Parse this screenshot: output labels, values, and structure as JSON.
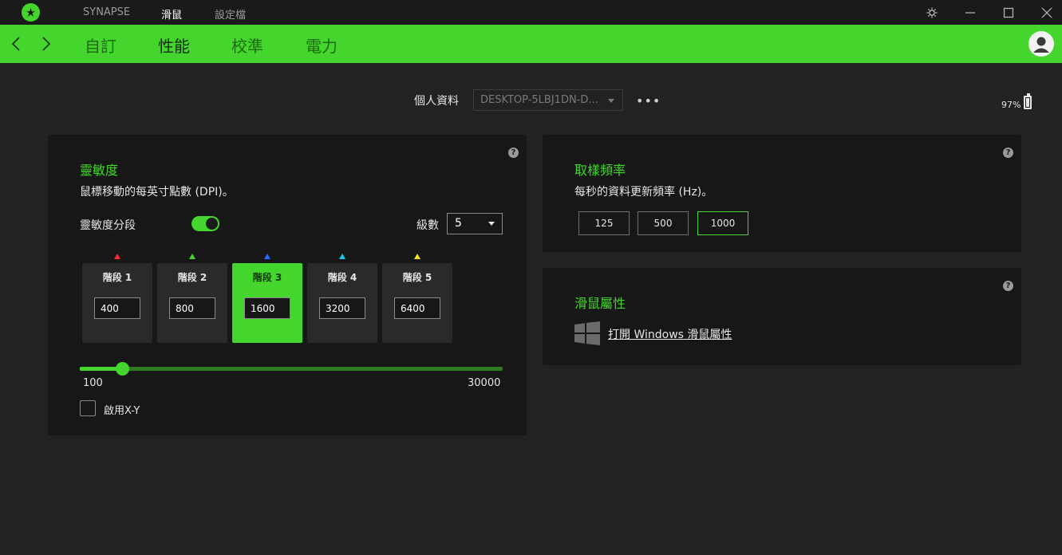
{
  "titlebar": {
    "logo_icon": "razer-snake-icon",
    "tabs": [
      {
        "label": "SYNAPSE",
        "active": false
      },
      {
        "label": "滑鼠",
        "active": true
      },
      {
        "label": "設定檔",
        "active": false
      }
    ],
    "controls": [
      "gear-icon",
      "minimize-icon",
      "maximize-icon",
      "close-icon"
    ]
  },
  "nav": {
    "tabs": [
      {
        "label": "自訂",
        "active": false
      },
      {
        "label": "性能",
        "active": true
      },
      {
        "label": "校準",
        "active": false
      },
      {
        "label": "電力",
        "active": false
      }
    ],
    "accent": "#44d62c"
  },
  "profile": {
    "label": "個人資料",
    "value": "DESKTOP-5LBJ1DN-D...",
    "more": "•••",
    "battery": "97%"
  },
  "sensitivity": {
    "title": "靈敏度",
    "description": "鼠標移動的每英寸點數 (DPI)。",
    "stages_label": "靈敏度分段",
    "stages_enabled": true,
    "level_label": "級數",
    "level_value": "5",
    "stages": [
      {
        "label": "階段 1",
        "dpi": "400",
        "color": "#ff2a2a",
        "active": false
      },
      {
        "label": "階段 2",
        "dpi": "800",
        "color": "#44d62c",
        "active": false
      },
      {
        "label": "階段 3",
        "dpi": "1600",
        "color": "#2a6bff",
        "active": true
      },
      {
        "label": "階段 4",
        "dpi": "3200",
        "color": "#1ec8f0",
        "active": false
      },
      {
        "label": "階段 5",
        "dpi": "6400",
        "color": "#f5e61e",
        "active": false
      }
    ],
    "slider_min": "100",
    "slider_max": "30000",
    "slider_value": 1600,
    "xy_label": "啟用X-Y",
    "xy_enabled": false
  },
  "polling": {
    "title": "取樣頻率",
    "description": "每秒的資料更新頻率 (Hz)。",
    "options": [
      {
        "label": "125",
        "active": false
      },
      {
        "label": "500",
        "active": false
      },
      {
        "label": "1000",
        "active": true
      }
    ]
  },
  "mouse_props": {
    "title": "滑鼠屬性",
    "link": "打開 Windows 滑鼠屬性",
    "icon": "windows-logo-icon"
  },
  "help": "?"
}
